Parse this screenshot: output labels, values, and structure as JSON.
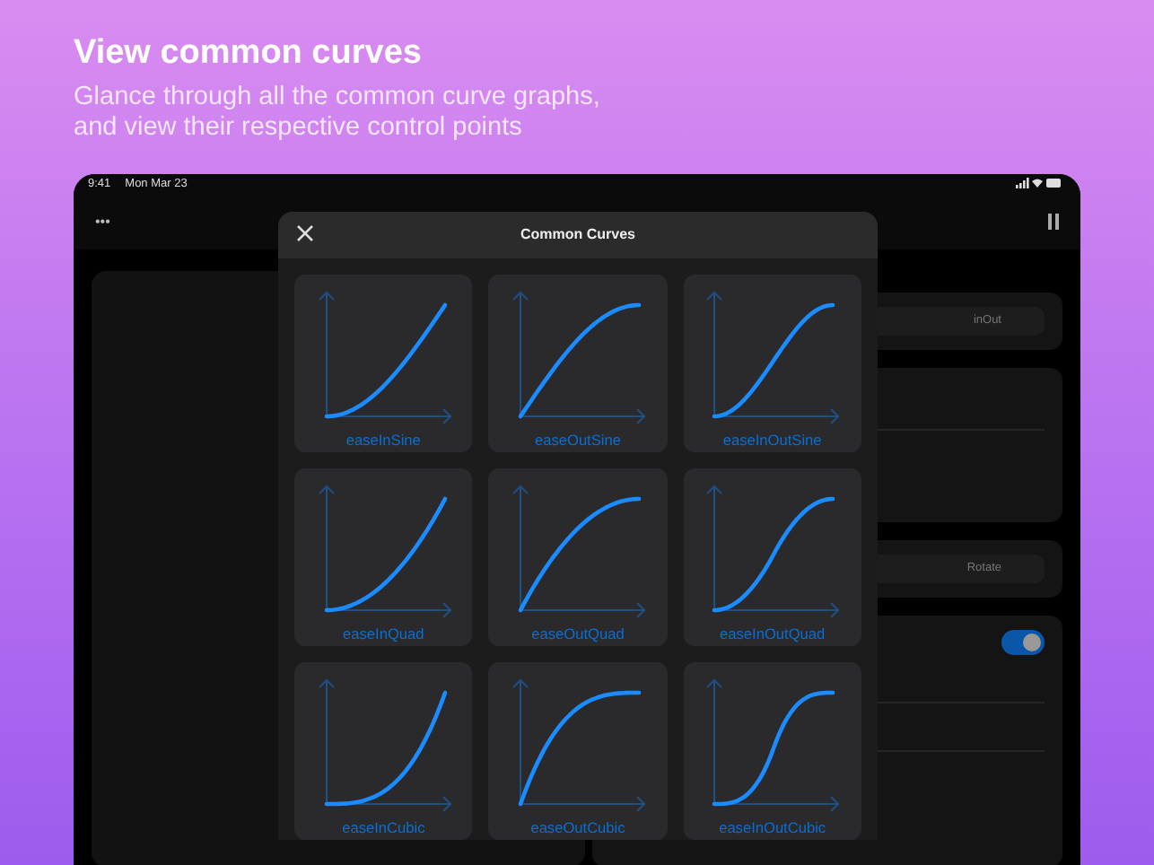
{
  "promo": {
    "title": "View common curves",
    "subtitle": "Glance through all the common curve graphs, and view their respective control points"
  },
  "status_bar": {
    "time": "9:41",
    "date": "Mon Mar 23"
  },
  "toolbar": {
    "more": "•••"
  },
  "background_panel": {
    "segment_1": "inOut",
    "segment_2": "Rotate",
    "toggle_on": true
  },
  "modal": {
    "title": "Common Curves",
    "curves": [
      {
        "label": "easeInSine",
        "kind": "in"
      },
      {
        "label": "easeOutSine",
        "kind": "out"
      },
      {
        "label": "easeInOutSine",
        "kind": "inOut"
      },
      {
        "label": "easeInQuad",
        "kind": "in"
      },
      {
        "label": "easeOutQuad",
        "kind": "out"
      },
      {
        "label": "easeInOutQuad",
        "kind": "inOut"
      },
      {
        "label": "easeInCubic",
        "kind": "in"
      },
      {
        "label": "easeOutCubic",
        "kind": "out"
      },
      {
        "label": "easeInOutCubic",
        "kind": "inOut"
      }
    ]
  }
}
